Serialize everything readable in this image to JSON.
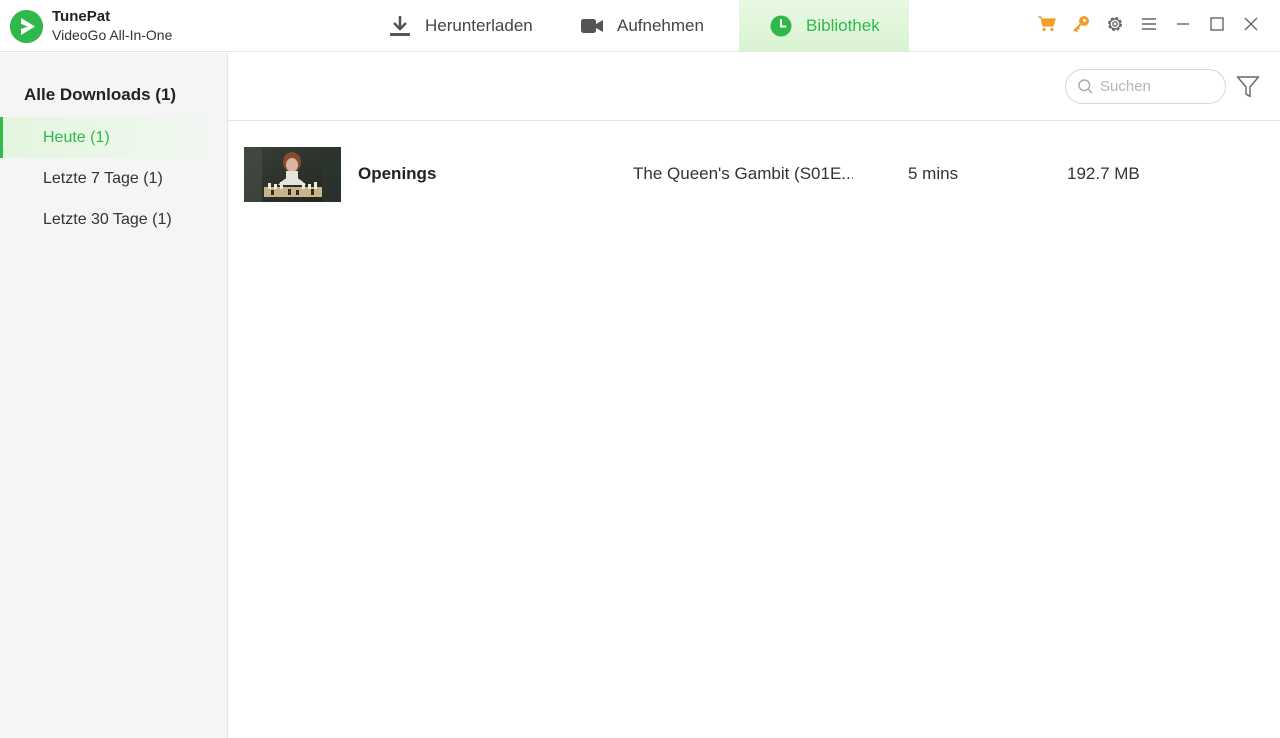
{
  "app": {
    "name": "TunePat",
    "subtitle": "VideoGo All-In-One",
    "accent": "#2fb94b",
    "icon": "tunepat-logo-icon"
  },
  "tabs": [
    {
      "label": "Herunterladen",
      "icon": "download-icon",
      "active": false
    },
    {
      "label": "Aufnehmen",
      "icon": "video-camera-icon",
      "active": false
    },
    {
      "label": "Bibliothek",
      "icon": "clock-icon",
      "active": true
    }
  ],
  "window_controls": [
    {
      "name": "cart-icon",
      "color": "#f39c2b"
    },
    {
      "name": "key-icon",
      "color": "#f39c2b"
    },
    {
      "name": "gear-icon",
      "color": "#666666"
    },
    {
      "name": "menu-icon",
      "color": "#666666"
    },
    {
      "name": "minimize-icon",
      "color": "#666666"
    },
    {
      "name": "maximize-icon",
      "color": "#666666"
    },
    {
      "name": "close-icon",
      "color": "#666666"
    }
  ],
  "sidebar": {
    "title": "Alle Downloads (1)",
    "items": [
      {
        "label": "Heute (1)",
        "active": true
      },
      {
        "label": "Letzte 7 Tage (1)",
        "active": false
      },
      {
        "label": "Letzte 30 Tage (1)",
        "active": false
      }
    ]
  },
  "toolbar": {
    "search_placeholder": "Suchen",
    "filter_icon": "filter-icon"
  },
  "library": {
    "rows": [
      {
        "title": "Openings",
        "show": "The Queen's Gambit (S01E...",
        "duration": "5 mins",
        "size": "192.7 MB",
        "thumbnail": "chess-scene-thumbnail"
      }
    ]
  }
}
